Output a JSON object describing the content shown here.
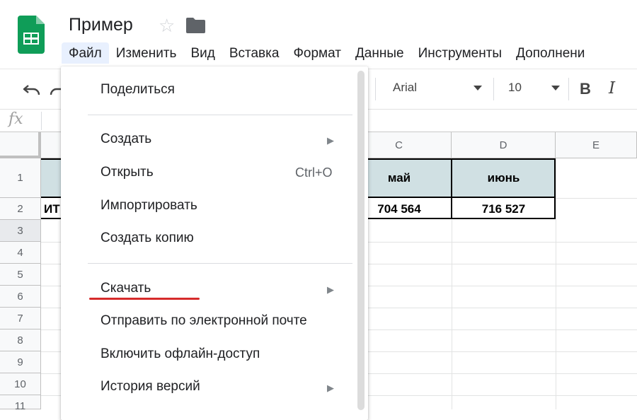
{
  "app": {
    "doc_title": "Пример",
    "accent_color": "#1a73e8",
    "logo_color": "#0f9d58"
  },
  "menubar": {
    "items": [
      "Файл",
      "Изменить",
      "Вид",
      "Вставка",
      "Формат",
      "Данные",
      "Инструменты",
      "Дополнени"
    ]
  },
  "toolbar": {
    "font": "Arial",
    "font_size": "10",
    "bold_label": "B",
    "italic_label": "I"
  },
  "formula_bar": {
    "fx_label": "fx"
  },
  "grid": {
    "columns": [
      "C",
      "D",
      "E"
    ],
    "rows": [
      "1",
      "2",
      "3",
      "4",
      "5",
      "6",
      "7",
      "8",
      "9",
      "10",
      "11"
    ],
    "row1": {
      "c": "май",
      "d": "июнь"
    },
    "row2": {
      "a": "ИТ",
      "c": "704 564",
      "d": "716 527"
    },
    "header_fill": "#d0e0e3"
  },
  "file_menu": {
    "share": "Поделиться",
    "create": "Создать",
    "open": "Открыть",
    "open_shortcut": "Ctrl+O",
    "import": "Импортировать",
    "copy": "Создать копию",
    "download": "Скачать",
    "email": "Отправить по электронной почте",
    "offline": "Включить офлайн-доступ",
    "history": "История версий",
    "highlight_color": "#d62b2b"
  }
}
